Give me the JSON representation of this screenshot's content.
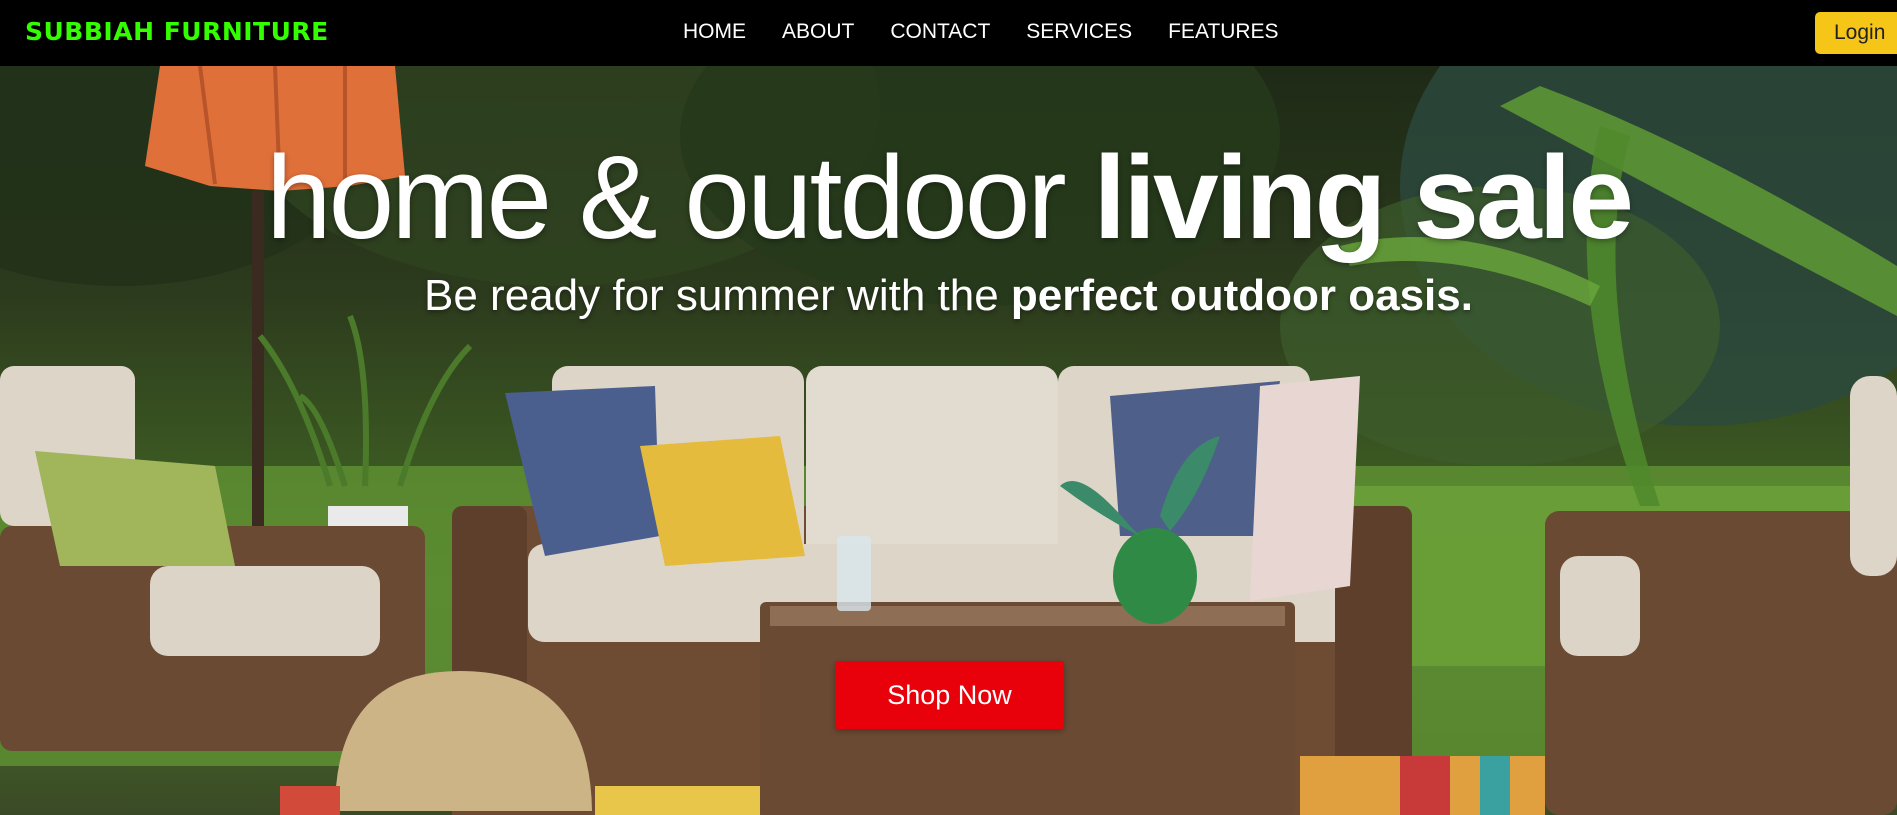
{
  "navbar": {
    "brand": "SUBBIAH FURNITURE",
    "links": [
      {
        "label": "HOME"
      },
      {
        "label": "ABOUT"
      },
      {
        "label": "CONTACT"
      },
      {
        "label": "SERVICES"
      },
      {
        "label": "FEATURES"
      }
    ],
    "login_label": "Login"
  },
  "hero": {
    "headline_light": "home & outdoor ",
    "headline_bold": "living sale",
    "subline_light": "Be ready for summer with the ",
    "subline_bold": "perfect outdoor oasis.",
    "cta_label": "Shop Now"
  },
  "colors": {
    "brand": "#33ff00",
    "navbar_bg": "#000000",
    "login_bg": "#f5c518",
    "cta_bg": "#e8000b"
  }
}
